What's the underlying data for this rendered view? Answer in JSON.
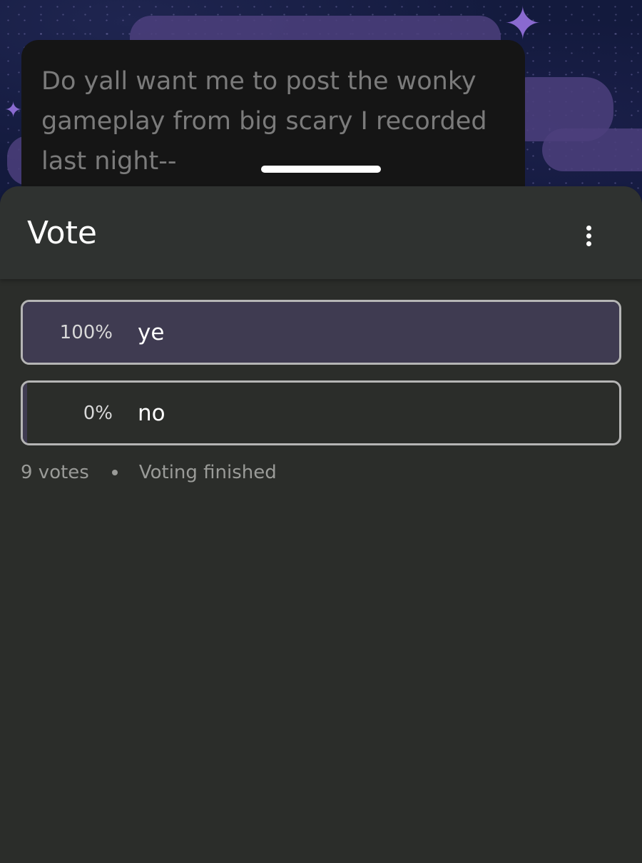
{
  "message": {
    "text": "Do yall want me to post the wonky gameplay from big scary I recorded last night--"
  },
  "sheet": {
    "title": "Vote",
    "more_icon": "more-vert-icon"
  },
  "poll": {
    "options": [
      {
        "percent_label": "100%",
        "label": "ye",
        "fill_fraction": 1.0
      },
      {
        "percent_label": "0%",
        "label": "no",
        "fill_fraction": 0.0
      }
    ],
    "votes_label": "9 votes",
    "status_label": "Voting finished"
  },
  "colors": {
    "sheet_bg": "#2b2d2a",
    "option_fill": "#3f3b51",
    "option_border": "#b5b5b5"
  }
}
